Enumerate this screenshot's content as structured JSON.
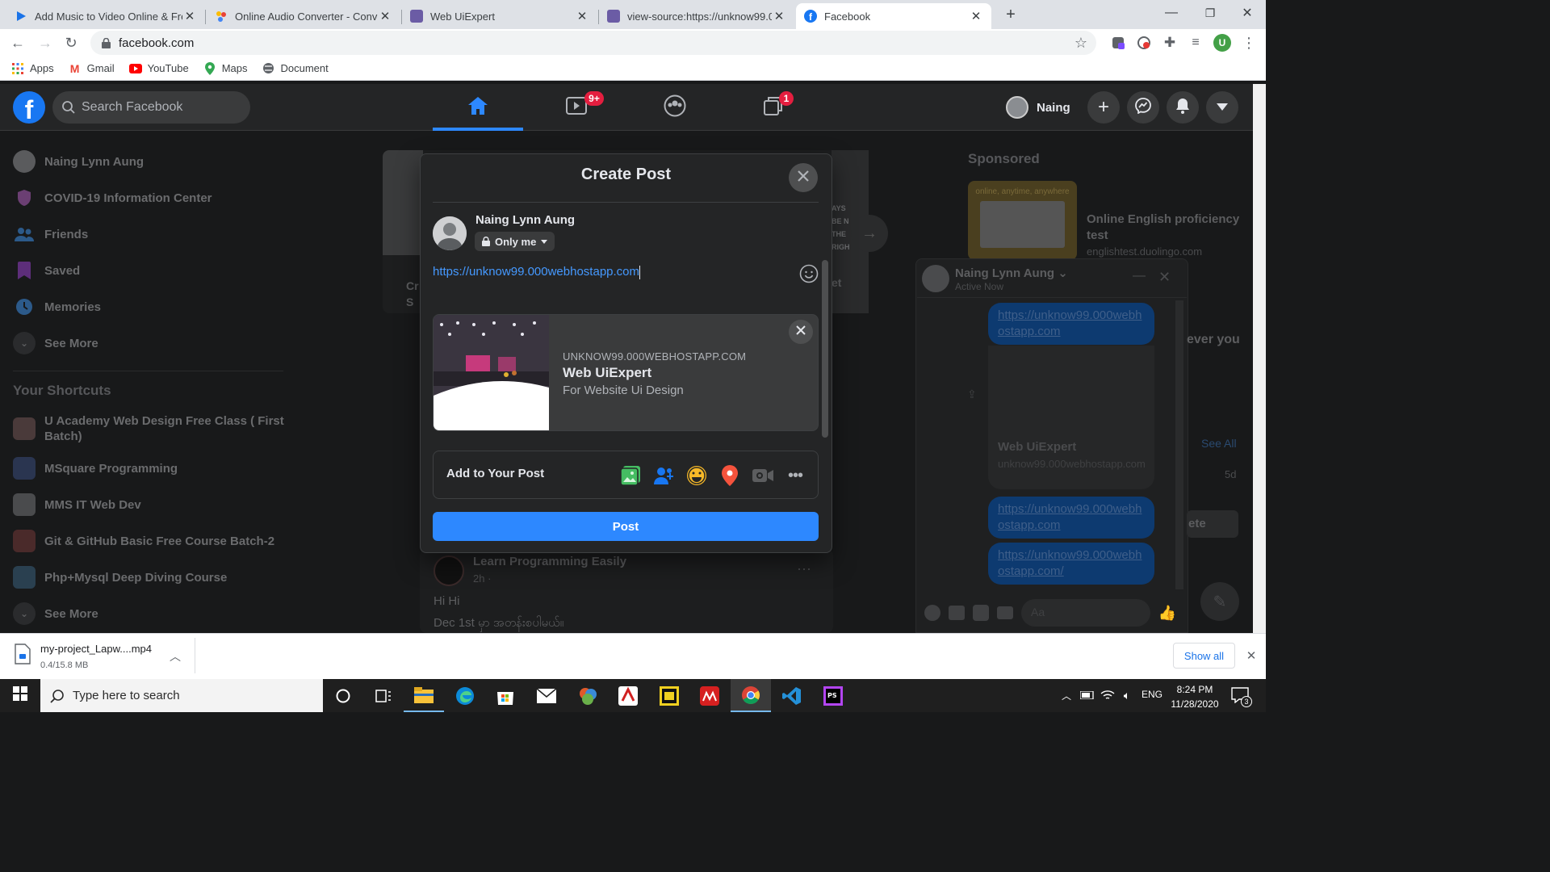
{
  "browser": {
    "tabs": [
      {
        "title": "Add Music to Video Online & Fre"
      },
      {
        "title": "Online Audio Converter - Conver"
      },
      {
        "title": "Web UiExpert"
      },
      {
        "title": "view-source:https://unknow99.00"
      },
      {
        "title": "Facebook"
      }
    ],
    "url": "facebook.com",
    "bookmarks": [
      "Apps",
      "Gmail",
      "YouTube",
      "Maps",
      "Document"
    ],
    "profile_initial": "U"
  },
  "fb": {
    "search_placeholder": "Search Facebook",
    "watch_badge": "9+",
    "gaming_badge": "1",
    "user_short": "Naing",
    "left_nav": [
      {
        "label": "Naing Lynn Aung"
      },
      {
        "label": "COVID-19 Information Center"
      },
      {
        "label": "Friends"
      },
      {
        "label": "Saved"
      },
      {
        "label": "Memories"
      },
      {
        "label": "See More"
      }
    ],
    "shortcuts_title": "Your Shortcuts",
    "shortcuts": [
      {
        "label": "U Academy Web Design Free Class ( First Batch)"
      },
      {
        "label": "MSquare Programming"
      },
      {
        "label": "MMS IT Web Dev"
      },
      {
        "label": "Git & GitHub Basic Free Course Batch-2"
      },
      {
        "label": "Php+Mysql Deep Diving Course"
      },
      {
        "label": "See More"
      }
    ],
    "sponsored_title": "Sponsored",
    "ad": {
      "title": "Online English proficiency test",
      "domain": "englishtest.duolingo.com",
      "image_text": "online, anytime, anywhere"
    },
    "story_bits": {
      "cr": "Cr",
      "s": "S",
      "text": "AYS BE N THE RIGH",
      "et": "et"
    },
    "feed_post": {
      "author": "Learn Programming Easily",
      "time": "2h ·",
      "body1": "Hi Hi",
      "body2": "Dec 1st မှာ အတန်းစပါမယ်။"
    },
    "chat": {
      "name": "Naing Lynn Aung",
      "status": "Active Now",
      "messages": [
        "https://unknow99.000webhostapp.com",
        "https://unknow99.000webhostapp.com",
        "https://unknow99.000webhostapp.com/"
      ],
      "preview_title": "Web UiExpert",
      "preview_domain": "unknow99.000webhostapp.com",
      "input_placeholder": "Aa",
      "side_text": {
        "ever": "ever you",
        "see_all": "See All",
        "time": "5d",
        "ete": "ete"
      }
    }
  },
  "modal": {
    "title": "Create Post",
    "author": "Naing Lynn Aung",
    "privacy": "Only me",
    "text": "https://unknow99.000webhostapp.com",
    "link_preview": {
      "domain": "UNKNOW99.000WEBHOSTAPP.COM",
      "title": "Web UiExpert",
      "description": "For Website Ui Design"
    },
    "add_to_post": "Add to Your Post",
    "post_button": "Post"
  },
  "download": {
    "filename": "my-project_Lapw....mp4",
    "progress": "0.4/15.8 MB",
    "show_all": "Show all"
  },
  "taskbar": {
    "search_placeholder": "Type here to search",
    "lang": "ENG",
    "time": "8:24 PM",
    "date": "11/28/2020",
    "notif_count": "3"
  },
  "colors": {
    "fb_blue": "#1877f2",
    "fb_dark": "#18191a",
    "fb_surface": "#242526",
    "link": "#2d88ff"
  }
}
